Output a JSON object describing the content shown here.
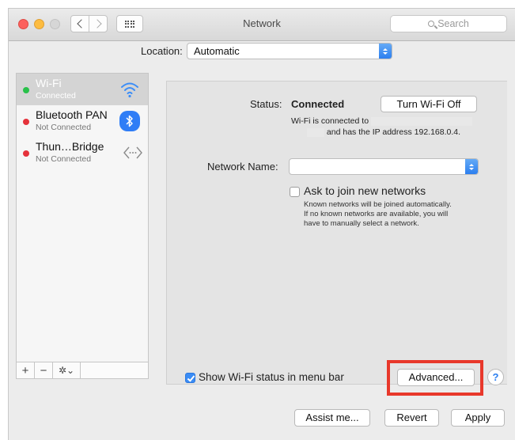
{
  "window": {
    "title": "Network"
  },
  "toolbar": {
    "search_placeholder": "Search"
  },
  "location": {
    "label": "Location:",
    "value": "Automatic"
  },
  "sidebar": {
    "items": [
      {
        "name": "Wi-Fi",
        "status": "Connected",
        "dot_color": "#29c14a",
        "icon": "wifi-icon",
        "selected": true
      },
      {
        "name": "Bluetooth PAN",
        "status": "Not Connected",
        "dot_color": "#e5323b",
        "icon": "bluetooth-icon",
        "selected": false
      },
      {
        "name": "Thun…Bridge",
        "status": "Not Connected",
        "dot_color": "#e5323b",
        "icon": "thunderbolt-bridge-icon",
        "selected": false
      }
    ],
    "add_label": "+",
    "remove_label": "−",
    "actions_label": "✲⌄"
  },
  "detail": {
    "status_label": "Status:",
    "status_value": "Connected",
    "turn_off_label": "Turn Wi-Fi Off",
    "status_desc_line1": "Wi-Fi is connected to",
    "status_desc_line2": "and has the IP address 192.168.0.4.",
    "network_name_label": "Network Name:",
    "network_name_value": "",
    "ask_label": "Ask to join new networks",
    "ask_help": "Known networks will be joined automatically. If no known networks are available, you will have to manually select a network.",
    "show_status_label": "Show Wi-Fi status in menu bar",
    "show_status_checked": true,
    "advanced_label": "Advanced...",
    "help_label": "?"
  },
  "footer": {
    "assist_label": "Assist me...",
    "revert_label": "Revert",
    "apply_label": "Apply"
  },
  "colors": {
    "accent": "#2c7fef",
    "highlight": "#e8382b"
  }
}
